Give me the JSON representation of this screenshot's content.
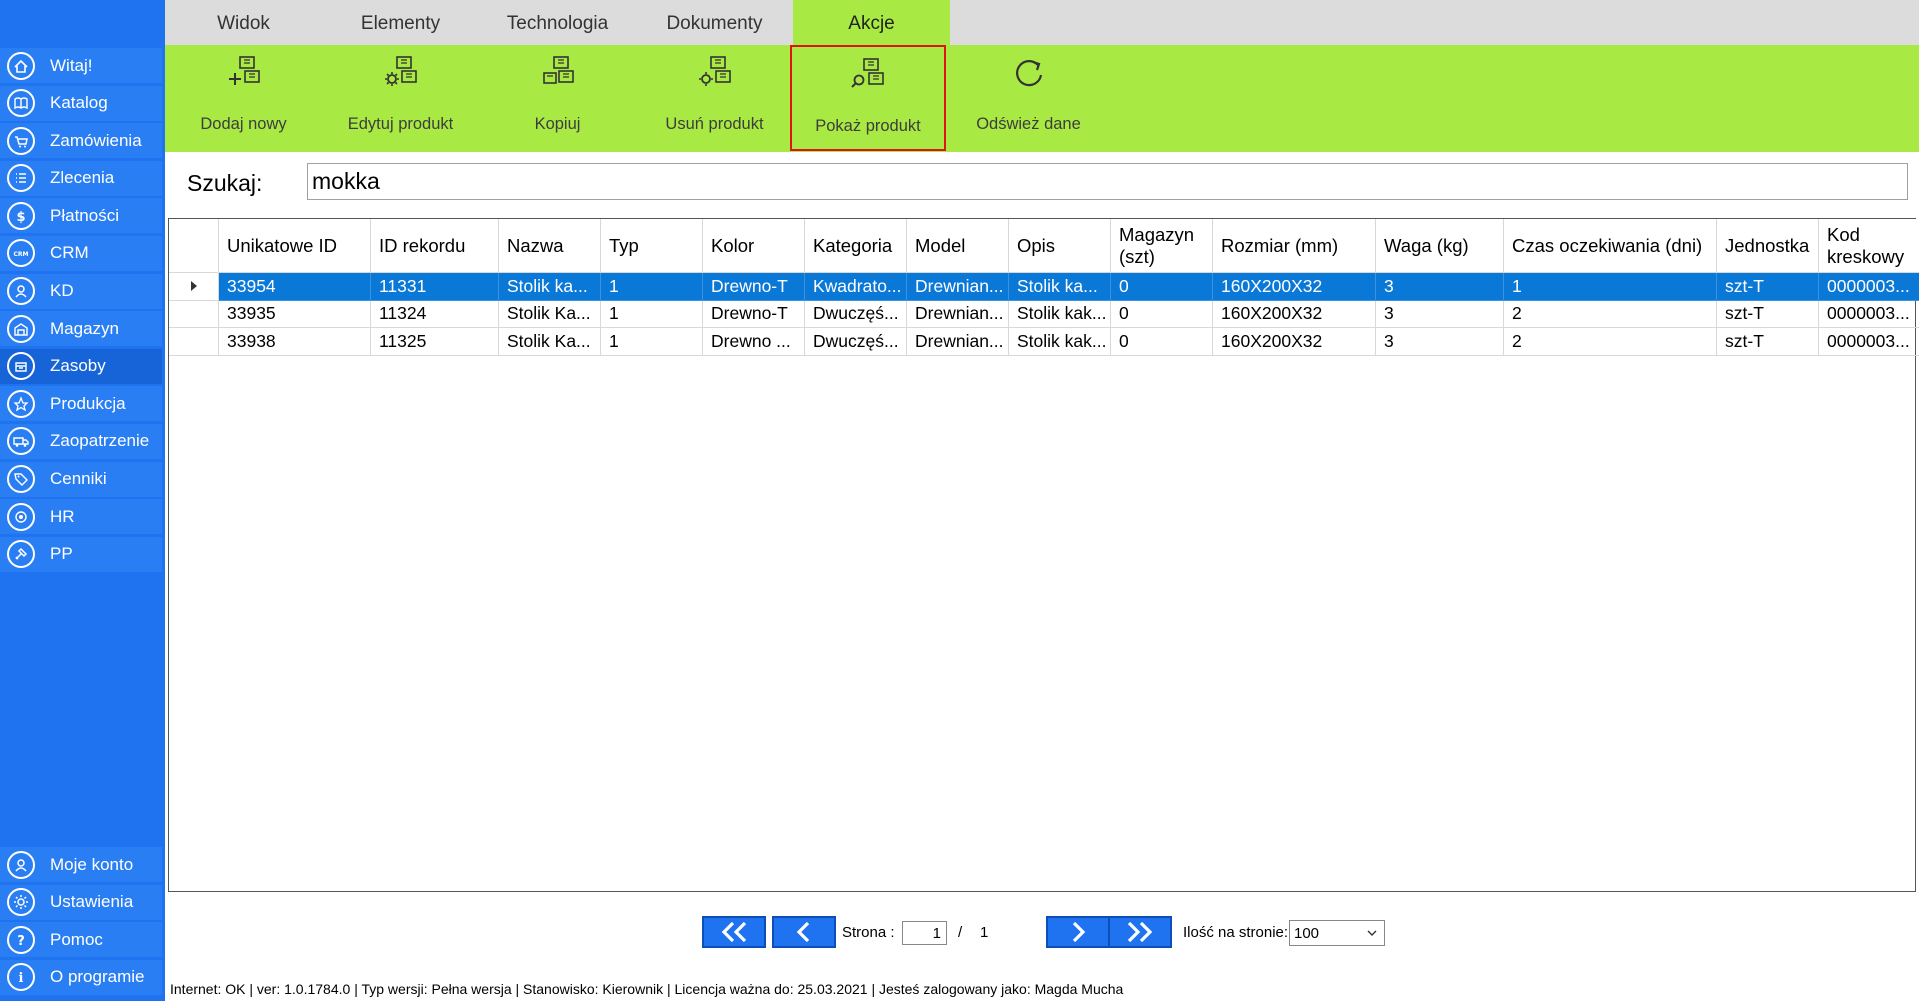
{
  "sidebar": {
    "top_items": [
      {
        "label": "Witaj!",
        "icon": "home-icon"
      },
      {
        "label": "Katalog",
        "icon": "book-icon"
      },
      {
        "label": "Zamówienia",
        "icon": "cart-icon"
      },
      {
        "label": "Zlecenia",
        "icon": "list-icon"
      },
      {
        "label": "Płatności",
        "icon": "dollar-icon"
      },
      {
        "label": "CRM",
        "icon": "crm-icon"
      },
      {
        "label": "KD",
        "icon": "user-badge-icon"
      },
      {
        "label": "Magazyn",
        "icon": "warehouse-icon"
      },
      {
        "label": "Zasoby",
        "icon": "box-icon",
        "active": true
      },
      {
        "label": "Produkcja",
        "icon": "production-icon"
      },
      {
        "label": "Zaopatrzenie",
        "icon": "truck-icon"
      },
      {
        "label": "Cenniki",
        "icon": "tag-icon"
      },
      {
        "label": "HR",
        "icon": "target-icon"
      },
      {
        "label": "PP",
        "icon": "tools-icon"
      }
    ],
    "bottom_items": [
      {
        "label": "Moje konto",
        "icon": "account-icon"
      },
      {
        "label": "Ustawienia",
        "icon": "gear-icon"
      },
      {
        "label": "Pomoc",
        "icon": "help-icon"
      },
      {
        "label": "O programie",
        "icon": "info-icon"
      }
    ]
  },
  "ribbon": {
    "tabs": [
      {
        "label": "Widok"
      },
      {
        "label": "Elementy"
      },
      {
        "label": "Technologia"
      },
      {
        "label": "Dokumenty"
      },
      {
        "label": "Akcje",
        "active": true
      }
    ],
    "buttons": [
      {
        "label": "Dodaj nowy",
        "icon": "add-product-icon"
      },
      {
        "label": "Edytuj produkt",
        "icon": "edit-product-icon"
      },
      {
        "label": "Kopiuj",
        "icon": "copy-product-icon"
      },
      {
        "label": "Usuń produkt",
        "icon": "delete-product-icon"
      },
      {
        "label": "Pokaż produkt",
        "icon": "show-product-icon",
        "highlighted": true
      },
      {
        "label": "Odśwież dane",
        "icon": "refresh-icon"
      }
    ]
  },
  "search": {
    "label": "Szukaj:",
    "value": "mokka"
  },
  "table": {
    "columns": [
      "",
      "Unikatowe ID",
      "ID rekordu",
      "Nazwa",
      "Typ",
      "Kolor",
      "Kategoria",
      "Model",
      "Opis",
      "Magazyn (szt)",
      "Rozmiar (mm)",
      "Waga (kg)",
      "Czas oczekiwania (dni)",
      "Jednostka",
      "Kod kreskowy"
    ],
    "rows": [
      {
        "selected": true,
        "cells": [
          "33954",
          "11331",
          "Stolik ka...",
          "1",
          "Drewno-T",
          "Kwadrato...",
          "Drewnian...",
          "Stolik ka...",
          "0",
          "160X200X32",
          "3",
          "1",
          "szt-T",
          "0000003..."
        ]
      },
      {
        "selected": false,
        "cells": [
          "33935",
          "11324",
          "Stolik Ka...",
          "1",
          "Drewno-T",
          "Dwuczęś...",
          "Drewnian...",
          "Stolik kak...",
          "0",
          "160X200X32",
          "3",
          "2",
          "szt-T",
          "0000003..."
        ]
      },
      {
        "selected": false,
        "cells": [
          "33938",
          "11325",
          "Stolik Ka...",
          "1",
          "Drewno ...",
          "Dwuczęś...",
          "Drewnian...",
          "Stolik kak...",
          "0",
          "160X200X32",
          "3",
          "2",
          "szt-T",
          "0000003..."
        ]
      }
    ]
  },
  "pagination": {
    "page_label": "Strona :",
    "current_page": "1",
    "separator": "/",
    "total_pages": "1",
    "per_page_label": "Ilość na stronie:",
    "per_page_value": "100"
  },
  "status": {
    "text": "Internet: OK  |   ver: 1.0.1784.0   |   Typ wersji: Pełna wersja   |   Stanowisko: Kierownik   |   Licencja ważna do: 25.03.2021   |   Jesteś zalogowany jako: Magda Mucha"
  },
  "colors": {
    "sidebar": "#1f73f0",
    "ribbon": "#a8ea43",
    "selected_row": "#0a78d7",
    "highlight_border": "#e01414"
  }
}
